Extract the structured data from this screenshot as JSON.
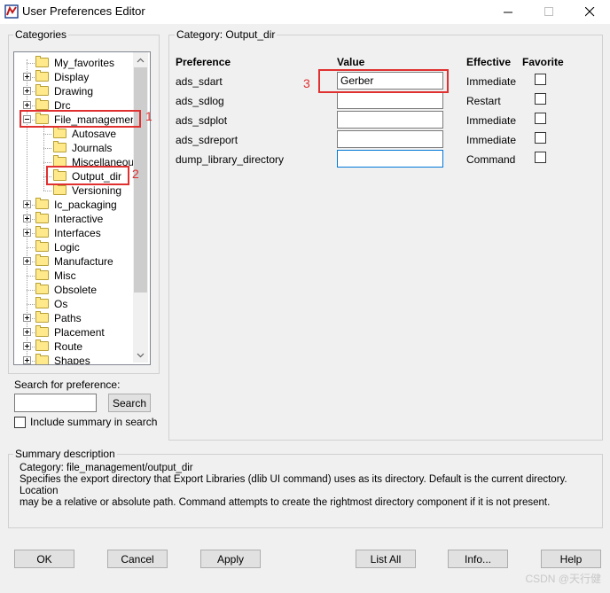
{
  "window": {
    "title": "User Preferences Editor",
    "minimize_icon": "minimize-icon",
    "maximize_icon": "maximize-icon",
    "close_icon": "close-icon"
  },
  "categories": {
    "label": "Categories",
    "tree": [
      {
        "label": "My_favorites",
        "expander": "none",
        "level": 0
      },
      {
        "label": "Display",
        "expander": "plus",
        "level": 0
      },
      {
        "label": "Drawing",
        "expander": "plus",
        "level": 0
      },
      {
        "label": "Drc",
        "expander": "plus",
        "level": 0
      },
      {
        "label": "File_management",
        "expander": "minus",
        "level": 0
      },
      {
        "label": "Autosave",
        "expander": "none",
        "level": 1
      },
      {
        "label": "Journals",
        "expander": "none",
        "level": 1
      },
      {
        "label": "Miscellaneous",
        "expander": "none",
        "level": 1
      },
      {
        "label": "Output_dir",
        "expander": "none",
        "level": 1,
        "selected": true
      },
      {
        "label": "Versioning",
        "expander": "none",
        "level": 1
      },
      {
        "label": "Ic_packaging",
        "expander": "plus",
        "level": 0
      },
      {
        "label": "Interactive",
        "expander": "plus",
        "level": 0
      },
      {
        "label": "Interfaces",
        "expander": "plus",
        "level": 0
      },
      {
        "label": "Logic",
        "expander": "none",
        "level": 0
      },
      {
        "label": "Manufacture",
        "expander": "plus",
        "level": 0
      },
      {
        "label": "Misc",
        "expander": "none",
        "level": 0
      },
      {
        "label": "Obsolete",
        "expander": "none",
        "level": 0
      },
      {
        "label": "Os",
        "expander": "none",
        "level": 0
      },
      {
        "label": "Paths",
        "expander": "plus",
        "level": 0
      },
      {
        "label": "Placement",
        "expander": "plus",
        "level": 0
      },
      {
        "label": "Route",
        "expander": "plus",
        "level": 0
      },
      {
        "label": "Shapes",
        "expander": "plus",
        "level": 0
      }
    ]
  },
  "search": {
    "label": "Search for preference:",
    "value": "",
    "button": "Search",
    "include_summary": "Include summary in search"
  },
  "category_panel": {
    "label": "Category:  Output_dir",
    "headers": {
      "preference": "Preference",
      "value": "Value",
      "effective": "Effective",
      "favorite": "Favorite"
    },
    "rows": [
      {
        "preference": "ads_sdart",
        "value": "Gerber",
        "effective": "Immediate"
      },
      {
        "preference": "ads_sdlog",
        "value": "",
        "effective": "Restart"
      },
      {
        "preference": "ads_sdplot",
        "value": "",
        "effective": "Immediate"
      },
      {
        "preference": "ads_sdreport",
        "value": "",
        "effective": "Immediate"
      },
      {
        "preference": "dump_library_directory",
        "value": "",
        "effective": "Command"
      }
    ]
  },
  "summary": {
    "label": "Summary description",
    "line1": "Category: file_management/output_dir",
    "line2": "Specifies the export directory that Export Libraries (dlib UI command) uses as its directory. Default is the current directory. Location",
    "line3": "may be a relative or absolute path. Command attempts to create the rightmost directory component if it is not present."
  },
  "buttons": {
    "ok": "OK",
    "cancel": "Cancel",
    "apply": "Apply",
    "list_all": "List All",
    "info": "Info...",
    "help": "Help"
  },
  "annotations": {
    "n1": "1",
    "n2": "2",
    "n3": "3",
    "color": "#e03030"
  },
  "watermark": "CSDN @天行健"
}
